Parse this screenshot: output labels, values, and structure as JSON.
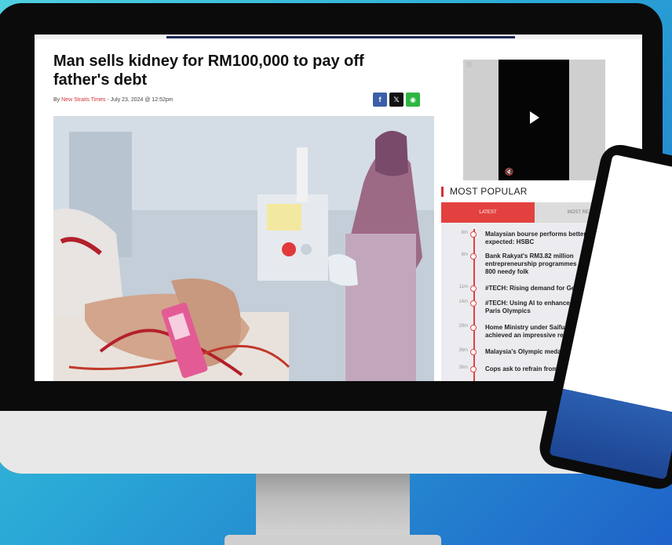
{
  "article": {
    "headline": "Man sells kidney for RM100,000 to pay off father's debt",
    "byline_prefix": "By ",
    "author": "New Straits Times",
    "date": " - July 23, 2024 @ 12:52pm",
    "share": {
      "facebook": "f",
      "x": "𝕏",
      "whatsapp": "◉"
    }
  },
  "video": {
    "ad_marker": "ⓘ",
    "play_icon": "play-icon",
    "mute_icon": "🔇"
  },
  "sidebar": {
    "title": "MOST POPULAR",
    "tabs": [
      {
        "label": "LATEST",
        "active": true
      },
      {
        "label": "MOST READ",
        "active": false
      }
    ],
    "items": [
      {
        "time": "8m",
        "text": "Malaysian bourse performs better than expected: HSBC"
      },
      {
        "time": "8m",
        "text": "Bank Rakyat's RM3.82 million entrepreneurship programmes set to benefit 800 needy folk"
      },
      {
        "time": "11m",
        "text": "#TECH: Rising demand for GenAI skills"
      },
      {
        "time": "14m",
        "text": "#TECH: Using AI to enhance sustainability at Paris Olympics"
      },
      {
        "time": "29m",
        "text": "Home Ministry under Saifuddin's watch has achieved an impressive record"
      },
      {
        "time": "36m",
        "text": "Malaysia's Olympic medal contenders"
      },
      {
        "time": "36m",
        "text": "Cops ask to refrain from speculating on"
      }
    ]
  },
  "colors": {
    "accent": "#e2413f",
    "nav": "#1e2a57"
  }
}
